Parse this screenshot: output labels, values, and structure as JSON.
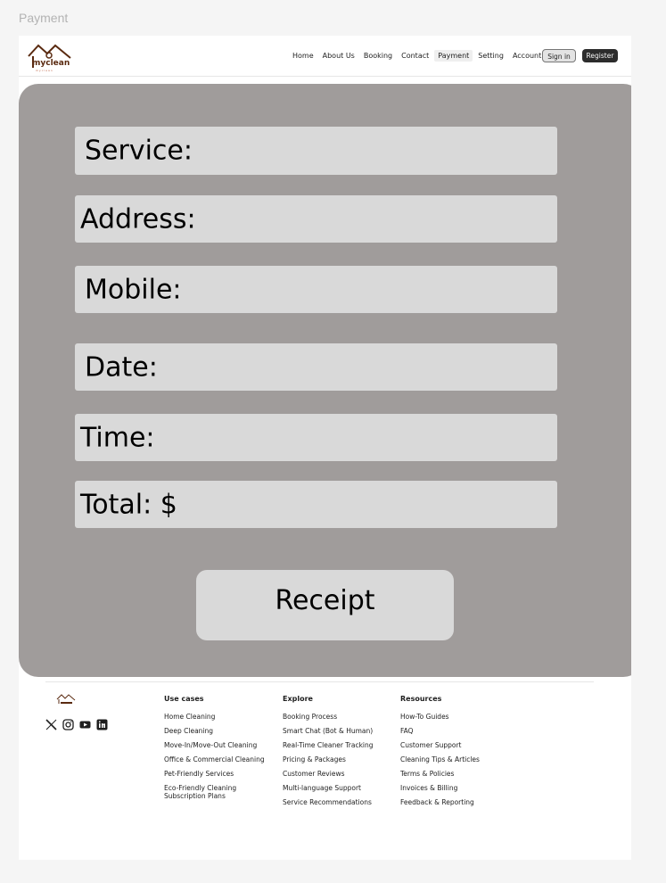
{
  "frame_label": "Payment",
  "brand": {
    "name": "myclean",
    "tagline": "myclean",
    "accent": "#5a2a10"
  },
  "nav": {
    "items": [
      "Home",
      "About Us",
      "Booking",
      "Contact",
      "Payment",
      "Setting",
      "Account"
    ],
    "active": "Payment",
    "sign_in": "Sign in",
    "register": "Register"
  },
  "form": {
    "service_label": "Service:",
    "address_label": "Address:",
    "mobile_label": "Mobile:",
    "date_label": "Date:",
    "time_label": "Time:",
    "total_label": "Total: $",
    "receipt_button": "Receipt"
  },
  "footer": {
    "social_icons": [
      "x-icon",
      "instagram-icon",
      "youtube-icon",
      "linkedin-icon"
    ],
    "columns": [
      {
        "title": "Use cases",
        "links": [
          "Home Cleaning",
          "Deep Cleaning",
          "Move-In/Move-Out Cleaning",
          "Office & Commercial Cleaning",
          "Pet-Friendly Services",
          "Eco-Friendly Cleaning Subscription Plans"
        ]
      },
      {
        "title": "Explore",
        "links": [
          "Booking Process",
          "Smart Chat (Bot & Human)",
          "Real-Time Cleaner Tracking",
          "Pricing & Packages",
          "Customer Reviews",
          "Multi-language Support",
          "Service Recommendations"
        ]
      },
      {
        "title": "Resources",
        "links": [
          "How-To Guides",
          "FAQ",
          "Customer Support",
          "Cleaning Tips & Articles",
          "Terms & Policies",
          "Invoices & Billing",
          "Feedback & Reporting"
        ]
      }
    ]
  },
  "colors": {
    "card": "#a09c9b",
    "field": "#d9d9d9",
    "button_dark": "#2c2c2c"
  }
}
